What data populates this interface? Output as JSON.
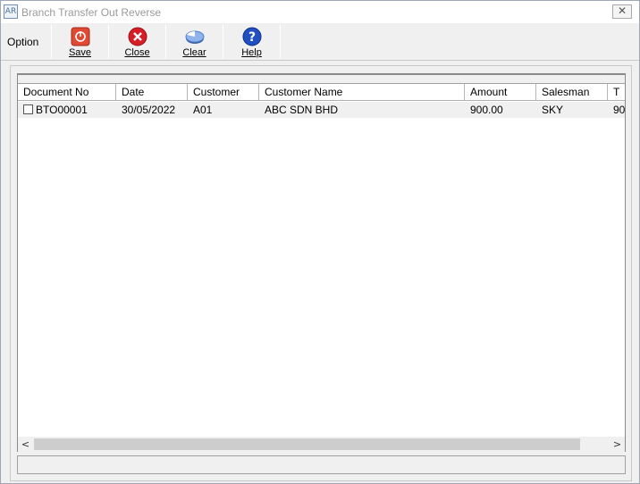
{
  "window": {
    "app_icon": "AR",
    "title": "Branch Transfer Out Reverse",
    "close_glyph": "✕"
  },
  "toolbar": {
    "option_label": "Option",
    "buttons": [
      {
        "label": "Save",
        "icon": "save-icon",
        "color": "#d9432f"
      },
      {
        "label": "Close",
        "icon": "close-circle-icon",
        "color": "#d61e27"
      },
      {
        "label": "Clear",
        "icon": "clear-pie-icon",
        "color": "#4a7fd0"
      },
      {
        "label": "Help",
        "icon": "help-icon",
        "color": "#1f4fc1"
      }
    ]
  },
  "grid": {
    "columns": [
      "Document No",
      "Date",
      "Customer",
      "Customer Name",
      "Amount",
      "Salesman",
      "T"
    ],
    "rows": [
      {
        "checked": false,
        "document_no": "BTO00001",
        "date": "30/05/2022",
        "customer": "A01",
        "customer_name": "ABC SDN BHD",
        "amount": "900.00",
        "salesman": "SKY",
        "t": "90"
      }
    ]
  },
  "scrollbar": {
    "left_arrow": "<",
    "right_arrow": ">"
  }
}
